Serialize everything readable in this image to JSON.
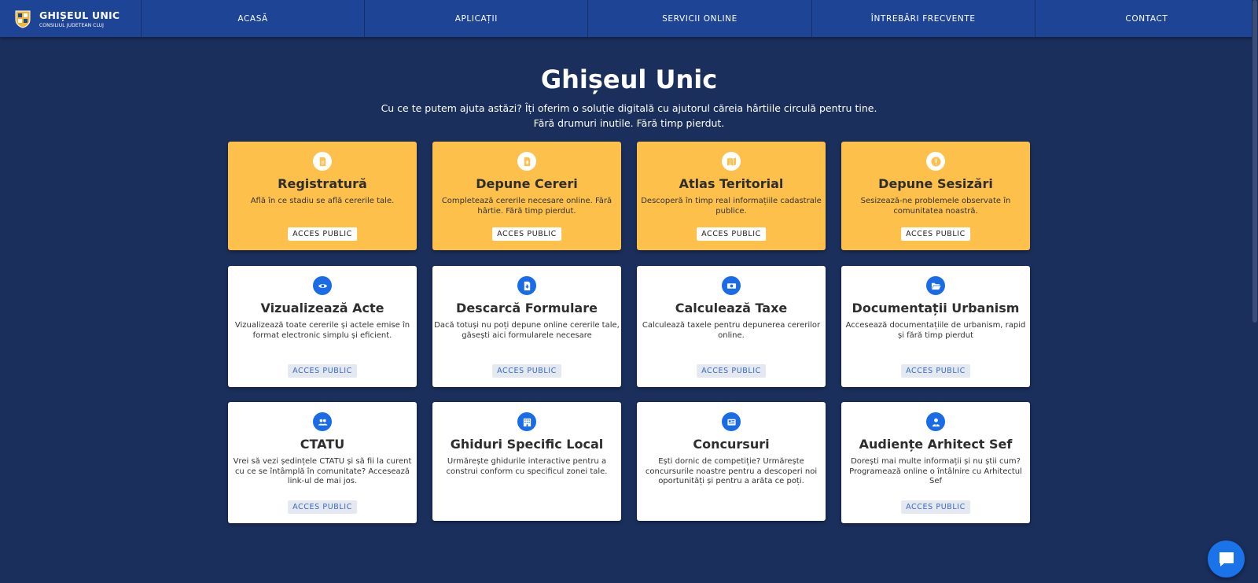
{
  "brand": {
    "title": "GHIȘEUL UNIC",
    "subtitle": "CONSILIUL JUDETEAN CLUJ"
  },
  "nav": [
    "ACASĂ",
    "APLICAȚII",
    "SERVICII ONLINE",
    "ÎNTREBĂRI FRECVENTE",
    "CONTACT"
  ],
  "hero": {
    "title": "Ghișeul Unic",
    "line1": "Cu ce te putem ajuta astăzi? Îți oferim o soluție digitală cu ajutorul căreia hârtiile circulă pentru tine.",
    "line2": "Fără drumuri inutile. Fără timp pierdut."
  },
  "cards": [
    {
      "title": "Registratură",
      "desc": "Află în ce stadiu se află cererile tale.",
      "badge": "ACCES PUBLIC",
      "icon": "document-icon",
      "style": "yellow"
    },
    {
      "title": "Depune Cereri",
      "desc": "Completează cererile necesare online. Fără hârtie. Fără timp pierdut.",
      "badge": "ACCES PUBLIC",
      "icon": "file-upload-icon",
      "style": "yellow"
    },
    {
      "title": "Atlas Teritorial",
      "desc": "Descoperă în timp real informațiile cadastrale publice.",
      "badge": "ACCES PUBLIC",
      "icon": "map-icon",
      "style": "yellow"
    },
    {
      "title": "Depune Sesizări",
      "desc": "Sesizează-ne problemele observate în comunitatea noastră.",
      "badge": "ACCES PUBLIC",
      "icon": "exclamation-icon",
      "style": "yellow"
    },
    {
      "title": "Vizualizează Acte",
      "desc": "Vizualizează toate cererile și actele emise în format electronic simplu și eficient.",
      "badge": "ACCES PUBLIC",
      "icon": "eye-icon",
      "style": "white"
    },
    {
      "title": "Descarcă Formulare",
      "desc": "Dacă totuși nu poți depune online cererile tale, găsești aici formularele necesare",
      "badge": "ACCES PUBLIC",
      "icon": "file-download-icon",
      "style": "white"
    },
    {
      "title": "Calculează Taxe",
      "desc": "Calculează taxele pentru depunerea cererilor online.",
      "badge": "ACCES PUBLIC",
      "icon": "money-icon",
      "style": "white"
    },
    {
      "title": "Documentații Urbanism",
      "desc": "Accesează documentațiile de urbanism, rapid și fără timp pierdut",
      "badge": "ACCES PUBLIC",
      "icon": "folder-open-icon",
      "style": "white"
    },
    {
      "title": "CTATU",
      "desc": "Vrei să vezi ședințele CTATU și să fii la curent cu ce se întâmplă în comunitate? Accesează link-ul de mai jos.",
      "badge": "ACCES PUBLIC",
      "icon": "users-icon",
      "style": "white"
    },
    {
      "title": "Ghiduri Specific Local",
      "desc": "Urmărește ghidurile interactive pentru a construi conform cu specificul zonei tale.",
      "badge": "",
      "icon": "building-icon",
      "style": "white"
    },
    {
      "title": "Concursuri",
      "desc": "Ești dornic de competiție? Urmărește concursurile noastre pentru a descoperi noi oportunități și pentru a arăta ce poți.",
      "badge": "",
      "icon": "newspaper-icon",
      "style": "white"
    },
    {
      "title": "Audiențe Arhitect Sef",
      "desc": "Dorești mai multe informații și nu știi cum? Programează online o întâlnire cu Arhitectul Sef",
      "badge": "ACCES PUBLIC",
      "icon": "user-tie-icon",
      "style": "white"
    }
  ],
  "colors": {
    "background": "#1b2f5c",
    "navbar": "#1e4496",
    "yellow_card": "#fcc04b",
    "icon_blue": "#1a6be6",
    "chat": "#1a73e8"
  },
  "chat": {
    "icon": "chat-icon"
  }
}
